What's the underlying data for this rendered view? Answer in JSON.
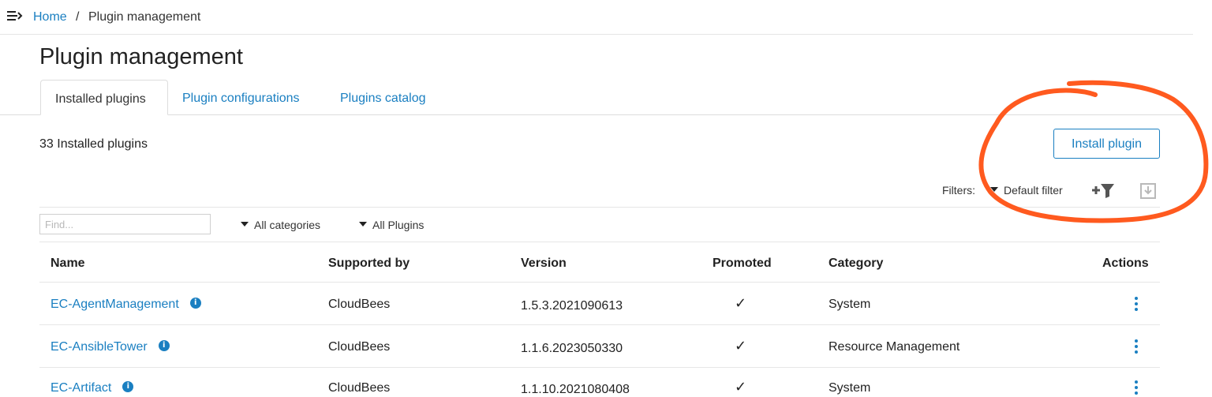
{
  "breadcrumb": {
    "home": "Home",
    "separator": "/",
    "current": "Plugin management"
  },
  "page": {
    "title": "Plugin management"
  },
  "tabs": [
    {
      "label": "Installed plugins",
      "active": true
    },
    {
      "label": "Plugin configurations",
      "active": false
    },
    {
      "label": "Plugins catalog",
      "active": false
    }
  ],
  "summary": {
    "count_text": "33 Installed plugins"
  },
  "actions": {
    "install_label": "Install plugin"
  },
  "filters": {
    "label": "Filters:",
    "selected": "Default filter"
  },
  "search": {
    "placeholder": "Find..."
  },
  "dropdowns": {
    "categories": "All categories",
    "plugins": "All Plugins"
  },
  "table": {
    "columns": [
      "Name",
      "Supported by",
      "Version",
      "Promoted",
      "Category",
      "Actions"
    ],
    "rows": [
      {
        "name": "EC-AgentManagement",
        "supported_by": "CloudBees",
        "version": "1.5.3.2021090613",
        "promoted": "✓",
        "category": "System"
      },
      {
        "name": "EC-AnsibleTower",
        "supported_by": "CloudBees",
        "version": "1.1.6.2023050330",
        "promoted": "✓",
        "category": "Resource Management"
      },
      {
        "name": "EC-Artifact",
        "supported_by": "CloudBees",
        "version": "1.1.10.2021080408",
        "promoted": "✓",
        "category": "System"
      }
    ]
  },
  "icons": {
    "menu": "menu-toggle-icon",
    "info": "info-icon",
    "add_filter": "add-filter-icon",
    "save_filter": "save-filter-icon",
    "row_actions": "kebab-menu-icon"
  },
  "colors": {
    "link": "#1a7fc1",
    "annotation": "#ff5a1f"
  }
}
